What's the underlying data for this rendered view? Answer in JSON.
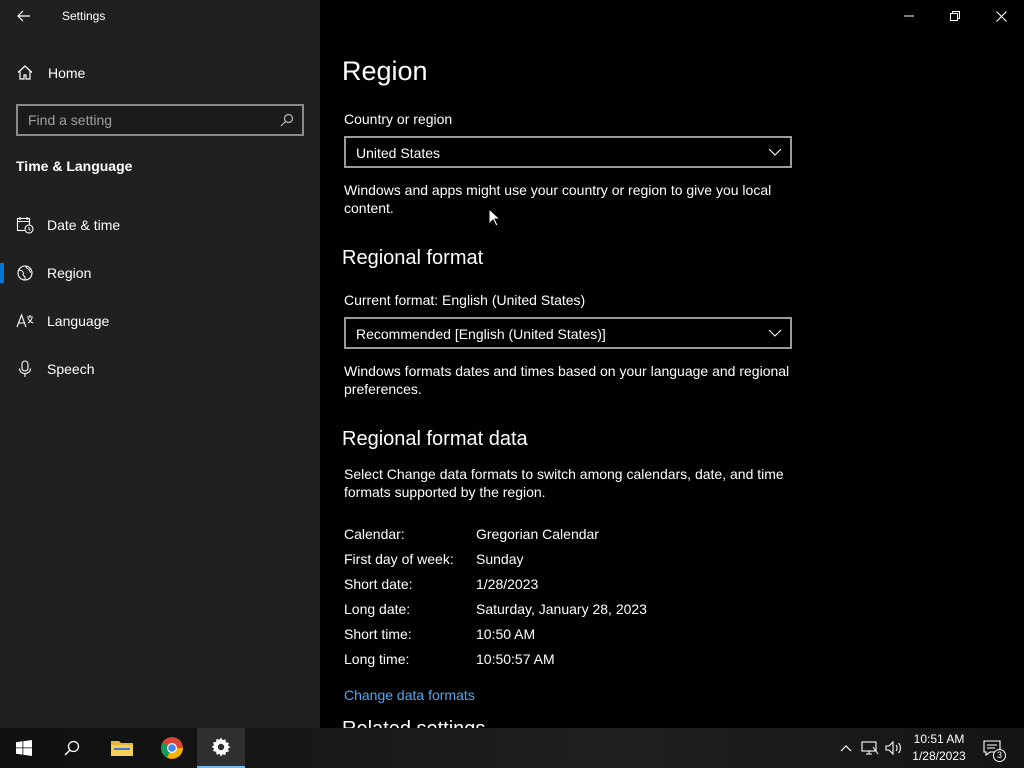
{
  "window": {
    "title": "Settings"
  },
  "sidebar": {
    "home_label": "Home",
    "search_placeholder": "Find a setting",
    "section_title": "Time & Language",
    "items": [
      {
        "label": "Date & time",
        "icon": "calendar-clock-icon",
        "selected": false
      },
      {
        "label": "Region",
        "icon": "globe-icon",
        "selected": true
      },
      {
        "label": "Language",
        "icon": "language-icon",
        "selected": false
      },
      {
        "label": "Speech",
        "icon": "microphone-icon",
        "selected": false
      }
    ]
  },
  "main": {
    "title": "Region",
    "country": {
      "label": "Country or region",
      "value": "United States",
      "description": "Windows and apps might use your country or region to give you local content."
    },
    "regional_format": {
      "heading": "Regional format",
      "current_label": "Current format: English (United States)",
      "value": "Recommended [English (United States)]",
      "description": "Windows formats dates and times based on your language and regional preferences."
    },
    "format_data": {
      "heading": "Regional format data",
      "description": "Select Change data formats to switch among calendars, date, and time formats supported by the region.",
      "rows": [
        {
          "key": "Calendar:",
          "value": "Gregorian Calendar"
        },
        {
          "key": "First day of week:",
          "value": "Sunday"
        },
        {
          "key": "Short date:",
          "value": "1/28/2023"
        },
        {
          "key": "Long date:",
          "value": "Saturday, January 28, 2023"
        },
        {
          "key": "Short time:",
          "value": "10:50 AM"
        },
        {
          "key": "Long time:",
          "value": "10:50:57 AM"
        }
      ],
      "change_link": "Change data formats"
    },
    "related_partial": "Related settings"
  },
  "taskbar": {
    "time": "10:51 AM",
    "date": "1/28/2023",
    "notification_count": "3"
  },
  "colors": {
    "accent": "#0078d7",
    "link": "#4ca8f0",
    "sidebar_bg": "#202020",
    "main_bg": "#000000"
  }
}
